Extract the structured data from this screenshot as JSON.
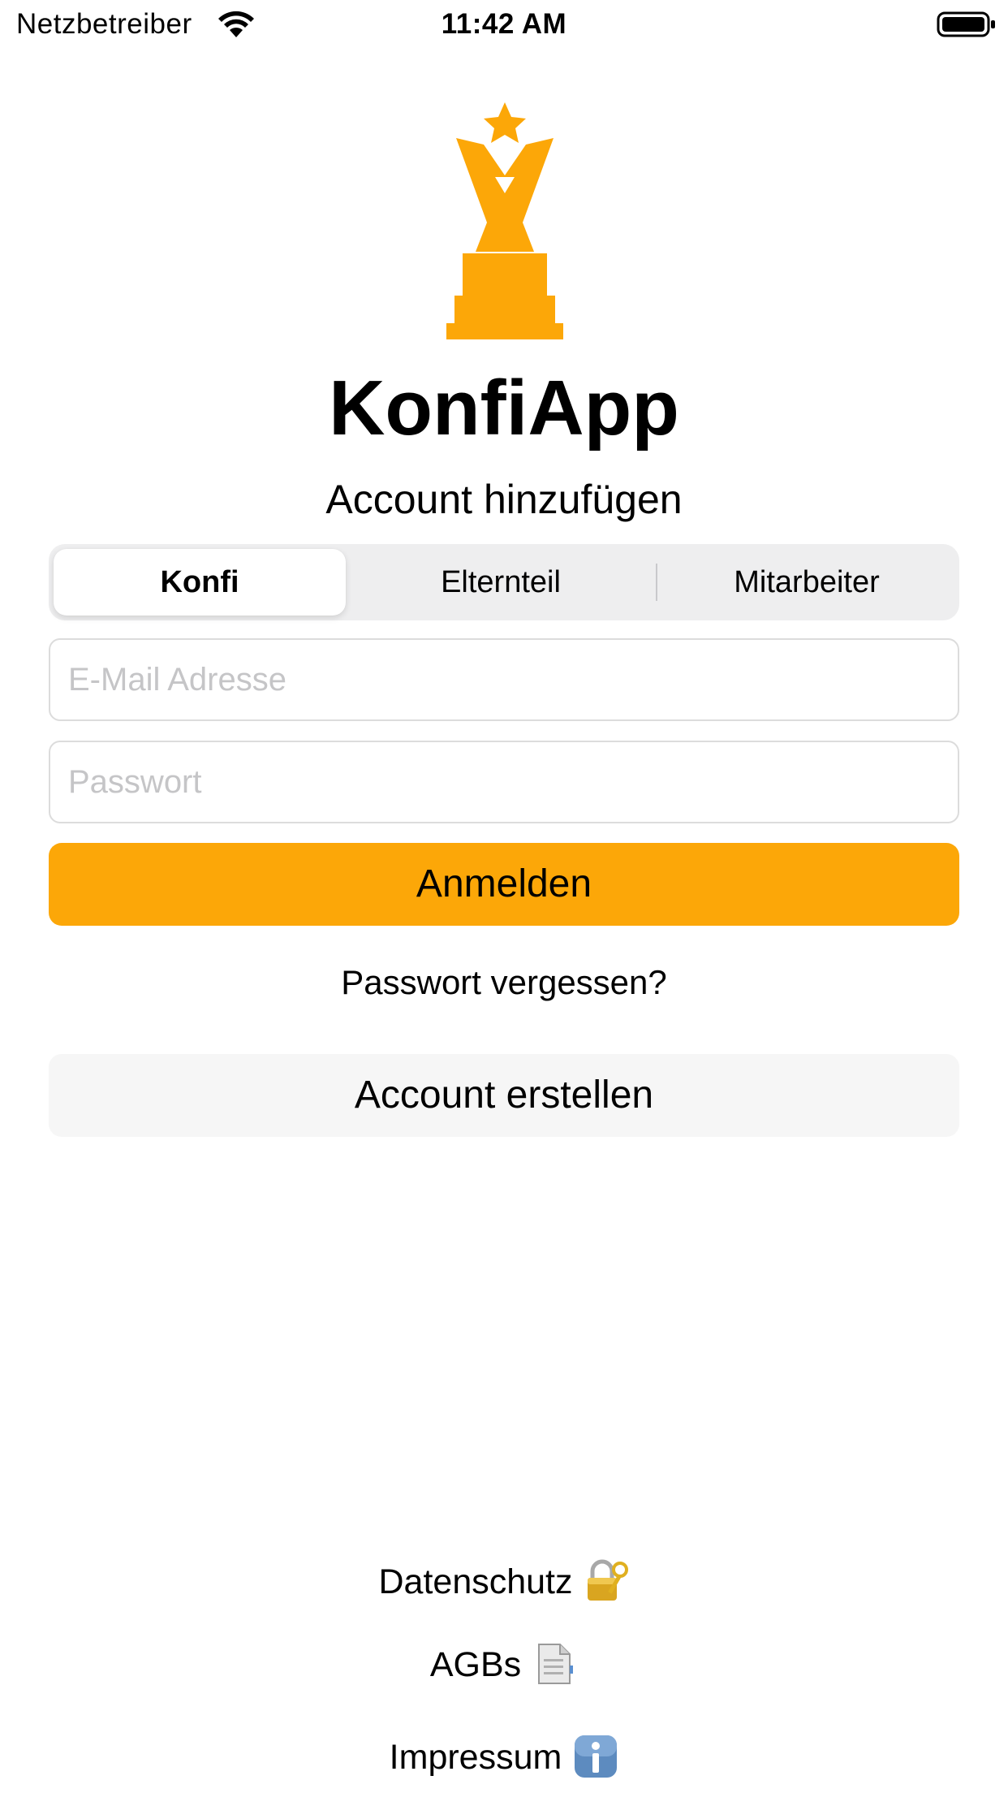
{
  "status_bar": {
    "carrier": "Netzbetreiber",
    "time": "11:42 AM"
  },
  "app": {
    "title": "KonfiApp",
    "subtitle": "Account hinzufügen",
    "accent_color": "#fca708",
    "logo_icon": "trophy-icon"
  },
  "role_selector": {
    "options": [
      {
        "label": "Konfi"
      },
      {
        "label": "Elternteil"
      },
      {
        "label": "Mitarbeiter"
      }
    ],
    "selected": "Konfi"
  },
  "form": {
    "email": {
      "placeholder": "E-Mail Adresse",
      "value": ""
    },
    "password": {
      "placeholder": "Passwort",
      "value": ""
    },
    "login_label": "Anmelden",
    "forgot_label": "Passwort vergessen?",
    "create_label": "Account erstellen"
  },
  "footer": {
    "links": [
      {
        "label": "Datenschutz",
        "icon": "lock-with-key-icon"
      },
      {
        "label": "AGBs",
        "icon": "document-icon"
      },
      {
        "label": "Impressum",
        "icon": "info-icon"
      }
    ]
  }
}
